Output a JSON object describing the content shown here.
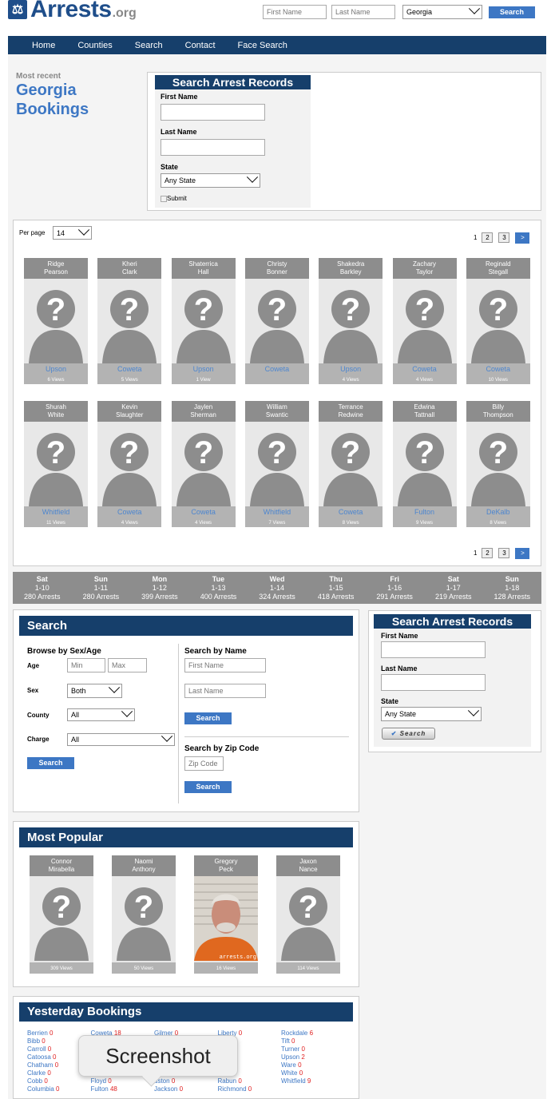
{
  "header": {
    "logo_name": "Arrests",
    "logo_tld": ".org",
    "first_placeholder": "First Name",
    "last_placeholder": "Last Name",
    "state_value": "Georgia",
    "search_label": "Search"
  },
  "nav": [
    "Home",
    "Counties",
    "Search",
    "Contact",
    "Face Search"
  ],
  "hero": {
    "kicker": "Most recent",
    "title_line1": "Georgia",
    "title_line2": "Bookings"
  },
  "search_box": {
    "title": "Search Arrest Records",
    "first_label": "First Name",
    "last_label": "Last Name",
    "state_label": "State",
    "state_value": "Any State",
    "submit_label": "Submit"
  },
  "per_page": {
    "label": "Per page",
    "value": "14"
  },
  "pagination": {
    "pages": [
      "1",
      "2",
      "3"
    ],
    "next": ">"
  },
  "bookings": [
    {
      "first": "Ridge",
      "last": "Pearson",
      "county": "Upson",
      "views": "6 Views"
    },
    {
      "first": "Kheri",
      "last": "Clark",
      "county": "Coweta",
      "views": "5 Views"
    },
    {
      "first": "Shaterrica",
      "last": "Hall",
      "county": "Upson",
      "views": "1 View"
    },
    {
      "first": "Christy",
      "last": "Bonner",
      "county": "Coweta",
      "views": ""
    },
    {
      "first": "Shakedra",
      "last": "Barkley",
      "county": "Upson",
      "views": "4 Views"
    },
    {
      "first": "Zachary",
      "last": "Taylor",
      "county": "Coweta",
      "views": "4 Views"
    },
    {
      "first": "Reginald",
      "last": "Stegall",
      "county": "Coweta",
      "views": "10 Views"
    },
    {
      "first": "Shurah",
      "last": "White",
      "county": "Whitfield",
      "views": "11 Views"
    },
    {
      "first": "Kevin",
      "last": "Slaughter",
      "county": "Coweta",
      "views": "4 Views"
    },
    {
      "first": "Jaylen",
      "last": "Sherman",
      "county": "Coweta",
      "views": "4 Views"
    },
    {
      "first": "William",
      "last": "Swantic",
      "county": "Whitfield",
      "views": "7 Views"
    },
    {
      "first": "Terrance",
      "last": "Redwine",
      "county": "Coweta",
      "views": "8 Views"
    },
    {
      "first": "Edwina",
      "last": "Tattnall",
      "county": "Fulton",
      "views": "9 Views"
    },
    {
      "first": "Billy",
      "last": "Thompson",
      "county": "DeKalb",
      "views": "8 Views"
    }
  ],
  "days": [
    {
      "day": "Sat",
      "date": "1-10",
      "count": "280 Arrests"
    },
    {
      "day": "Sun",
      "date": "1-11",
      "count": "280 Arrests"
    },
    {
      "day": "Mon",
      "date": "1-12",
      "count": "399 Arrests"
    },
    {
      "day": "Tue",
      "date": "1-13",
      "count": "400 Arrests"
    },
    {
      "day": "Wed",
      "date": "1-14",
      "count": "324 Arrests"
    },
    {
      "day": "Thu",
      "date": "1-15",
      "count": "418 Arrests"
    },
    {
      "day": "Fri",
      "date": "1-16",
      "count": "291 Arrests"
    },
    {
      "day": "Sat",
      "date": "1-17",
      "count": "219 Arrests"
    },
    {
      "day": "Sun",
      "date": "1-18",
      "count": "128 Arrests"
    }
  ],
  "search_panel": {
    "title": "Search",
    "browse_title": "Browse by Sex/Age",
    "age_label": "Age",
    "min_ph": "Min",
    "max_ph": "Max",
    "sex_label": "Sex",
    "sex_value": "Both",
    "county_label": "County",
    "county_value": "All",
    "charge_label": "Charge",
    "charge_value": "All",
    "search_label": "Search",
    "name_title": "Search by Name",
    "first_ph": "First Name",
    "last_ph": "Last Name",
    "zip_title": "Search by Zip Code",
    "zip_ph": "Zip Code"
  },
  "side_search": {
    "title": "Search Arrest Records",
    "first_label": "First Name",
    "last_label": "Last Name",
    "state_label": "State",
    "state_value": "Any State",
    "search_label": "Search"
  },
  "popular": {
    "title": "Most Popular",
    "items": [
      {
        "first": "Connor",
        "last": "Mirabella",
        "views": "309 Views",
        "photo": "silhouette"
      },
      {
        "first": "Naomi",
        "last": "Anthony",
        "views": "50 Views",
        "photo": "silhouette"
      },
      {
        "first": "Gregory",
        "last": "Peck",
        "views": "16 Views",
        "photo": "mugshot",
        "watermark": "arrests.org"
      },
      {
        "first": "Jaxon",
        "last": "Nance",
        "views": "114 Views",
        "photo": "silhouette"
      }
    ]
  },
  "yesterday": {
    "title": "Yesterday Bookings",
    "columns": [
      [
        {
          "n": "Berrien",
          "c": "0"
        },
        {
          "n": "Bibb",
          "c": "0"
        },
        {
          "n": "Carroll",
          "c": "0"
        },
        {
          "n": "Catoosa",
          "c": "0"
        },
        {
          "n": "Chatham",
          "c": "0"
        },
        {
          "n": "Clarke",
          "c": "0"
        },
        {
          "n": "Cobb",
          "c": "0"
        },
        {
          "n": "Columbia",
          "c": "0"
        }
      ],
      [
        {
          "n": "Coweta",
          "c": "18"
        },
        {
          "n": "",
          "c": ""
        },
        {
          "n": "",
          "c": ""
        },
        {
          "n": "",
          "c": ""
        },
        {
          "n": "",
          "c": ""
        },
        {
          "n": "",
          "c": ""
        },
        {
          "n": "Floyd",
          "c": "0"
        },
        {
          "n": "Fulton",
          "c": "48"
        }
      ],
      [
        {
          "n": "Gilmer",
          "c": "0"
        },
        {
          "n": "",
          "c": ""
        },
        {
          "n": "",
          "c": ""
        },
        {
          "n": "",
          "c": ""
        },
        {
          "n": "",
          "c": ""
        },
        {
          "n": "",
          "c": ""
        },
        {
          "n": "uston",
          "c": "0"
        },
        {
          "n": "Jackson",
          "c": "0"
        }
      ],
      [
        {
          "n": "Liberty",
          "c": "0"
        },
        {
          "n": "on",
          "c": "0"
        },
        {
          "n": "gee",
          "c": "0"
        },
        {
          "n": "n",
          "c": "0"
        },
        {
          "n": "e",
          "c": "8"
        },
        {
          "n": "s",
          "c": "3"
        },
        {
          "n": "Rabun",
          "c": "0"
        },
        {
          "n": "Richmond",
          "c": "0"
        }
      ],
      [
        {
          "n": "Rockdale",
          "c": "6"
        },
        {
          "n": "Tift",
          "c": "0"
        },
        {
          "n": "Turner",
          "c": "0"
        },
        {
          "n": "Upson",
          "c": "2"
        },
        {
          "n": "Ware",
          "c": "0"
        },
        {
          "n": "White",
          "c": "0"
        },
        {
          "n": "Whitfield",
          "c": "9"
        }
      ]
    ]
  },
  "tooltip": "Screenshot"
}
